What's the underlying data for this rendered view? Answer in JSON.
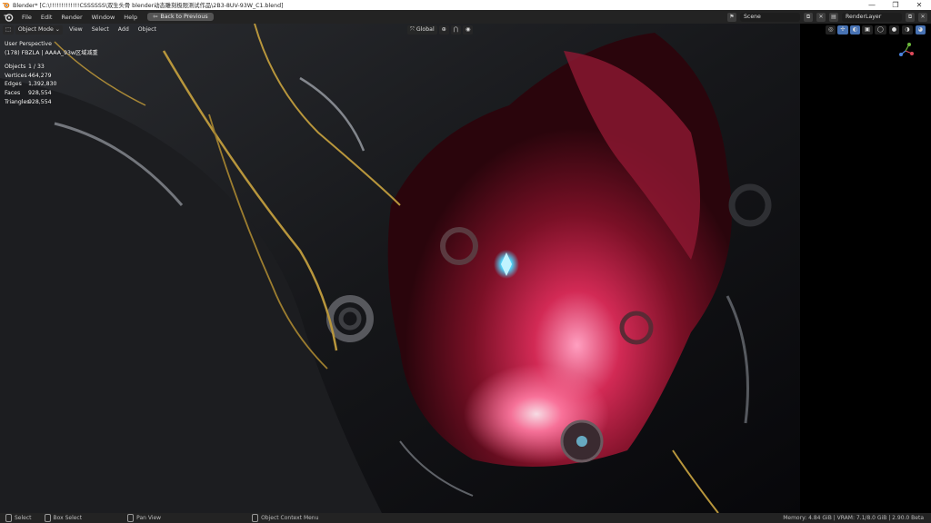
{
  "window": {
    "title": "Blender* [C:\\!!!!!!!!!!!!!CSSSSSS\\双生头骨  blender动态雕刻极限测试作品\\2B3-8UV-93W_C1.blend]",
    "minimize": "—",
    "maximize": "❐",
    "close": "✕"
  },
  "menu": {
    "items": [
      "File",
      "Edit",
      "Render",
      "Window",
      "Help"
    ],
    "back_to_previous": "Back to Previous",
    "scene": "Scene",
    "render_layer": "RenderLayer"
  },
  "viewport_header": {
    "mode": "Object Mode",
    "view": "View",
    "select": "Select",
    "add": "Add",
    "object": "Object",
    "orientation": "Global"
  },
  "overlay": {
    "perspective": "User Perspective",
    "collection": "(178) FBZLA | AAAA_93w区域减重",
    "stats": [
      {
        "label": "Objects",
        "value": "1 / 33"
      },
      {
        "label": "Vertices",
        "value": "464,279"
      },
      {
        "label": "Edges",
        "value": "1,392,830"
      },
      {
        "label": "Faces",
        "value": "928,554"
      },
      {
        "label": "Triangles",
        "value": "928,554"
      }
    ]
  },
  "statusbar": {
    "select": "Select",
    "box_select": "Box Select",
    "pan_view": "Pan View",
    "context_menu": "Object Context Menu",
    "memory": "Memory: 4.84 GiB | VRAM: 7.1/8.0 GiB | 2.90.0 Beta"
  },
  "colors": {
    "accent": "#4772b3",
    "header": "#232323",
    "crimson": "#b0203c",
    "gold": "#b8963c",
    "crystal": "#4fd8ff"
  }
}
